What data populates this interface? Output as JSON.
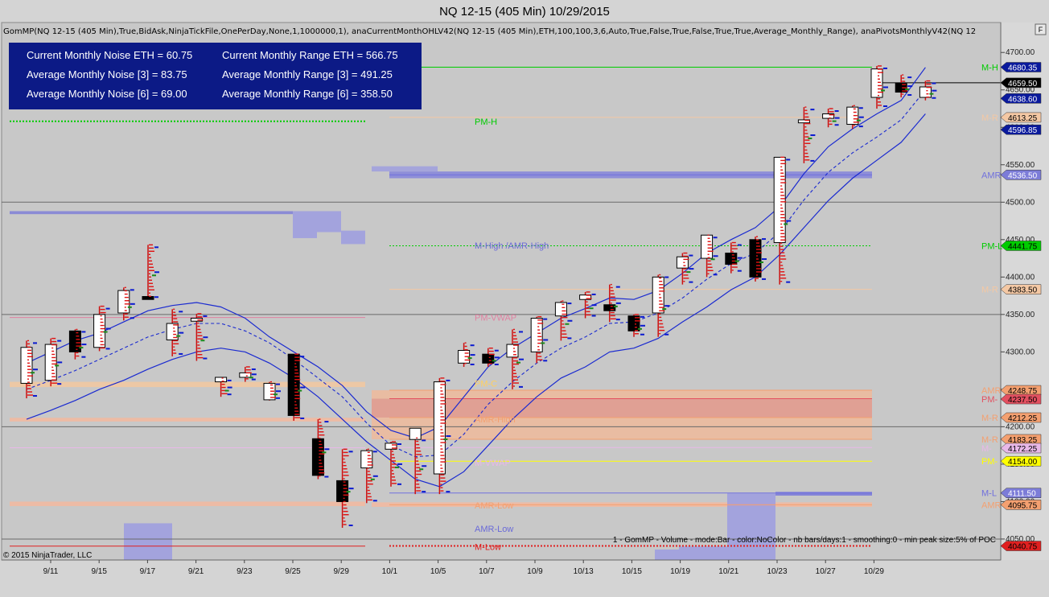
{
  "window": {
    "title": "NQ 12-15 (405 Min)  10/29/2015",
    "indicator_line": "GomMP(NQ 12-15 (405 Min),True,BidAsk,NinjaTickFile,OnePerDay,None,1,1000000,1), anaCurrentMonthOHLV42(NQ 12-15 (405 Min),ETH,100,100,3,6,Auto,True,False,True,False,True,True,Average_Monthly_Range), anaPivotsMonthlyV42(NQ 12",
    "copyright": "© 2015 NinjaTrader, LLC",
    "gom_note": "1 - GomMP - Volume - mode:Bar - color:NoColor - nb bars/days:1 - smoothing:0 - min peak size:5% of POC",
    "corner_button": "F"
  },
  "stats_box": {
    "left": [
      "Current Monthly Noise ETH = 60.75",
      "Average Monthly Noise [3] = 83.75",
      "Average Monthly Noise [6] = 69.00"
    ],
    "right": [
      "Current Monthly Range ETH = 566.75",
      "Average Monthly Range [3] = 491.25",
      "Average Monthly Range [6] = 358.50"
    ],
    "bg_color": "#0c1a86"
  },
  "chart_data": {
    "type": "candlestick",
    "title": "NQ 12-15 (405 Min)  10/29/2015",
    "x_tick_labels": [
      "9/11",
      "9/15",
      "9/17",
      "9/21",
      "9/23",
      "9/25",
      "9/29",
      "10/1",
      "10/5",
      "10/7",
      "10/9",
      "10/13",
      "10/15",
      "10/19",
      "10/21",
      "10/23",
      "10/27",
      "10/29"
    ],
    "y_ticks": [
      4050,
      4100,
      4150,
      4200,
      4250,
      4300,
      4350,
      4400,
      4450,
      4500,
      4550,
      4600,
      4650,
      4700
    ],
    "y_tick_labels": [
      "4050.00",
      "4100.00",
      "4150.00",
      "4200.00",
      "4250.00",
      "4300.00",
      "4350.00",
      "4400.00",
      "4450.00",
      "4500.00",
      "4550.00",
      "4600.00",
      "4650.00",
      "4700.00"
    ],
    "ylim": [
      4022,
      4740
    ],
    "bars": [
      {
        "o": 4258,
        "h": 4315,
        "l": 4238,
        "c": 4306
      },
      {
        "o": 4262,
        "h": 4318,
        "l": 4254,
        "c": 4310
      },
      {
        "o": 4328,
        "h": 4330,
        "l": 4290,
        "c": 4300
      },
      {
        "o": 4306,
        "h": 4361,
        "l": 4301,
        "c": 4350
      },
      {
        "o": 4352,
        "h": 4386,
        "l": 4342,
        "c": 4382
      },
      {
        "o": 4374,
        "h": 4443,
        "l": 4370,
        "c": 4370
      },
      {
        "o": 4316,
        "h": 4357,
        "l": 4294,
        "c": 4338
      },
      {
        "o": 4341,
        "h": 4351,
        "l": 4288,
        "c": 4345
      },
      {
        "o": 4260,
        "h": 4265,
        "l": 4240,
        "c": 4266
      },
      {
        "o": 4266,
        "h": 4280,
        "l": 4260,
        "c": 4272
      },
      {
        "o": 4236,
        "h": 4260,
        "l": 4235,
        "c": 4258
      },
      {
        "o": 4297,
        "h": 4297,
        "l": 4208,
        "c": 4215
      },
      {
        "o": 4184,
        "h": 4210,
        "l": 4130,
        "c": 4135
      },
      {
        "o": 4128,
        "h": 4170,
        "l": 4065,
        "c": 4100
      },
      {
        "o": 4145,
        "h": 4170,
        "l": 4098,
        "c": 4168
      },
      {
        "o": 4170,
        "h": 4180,
        "l": 4120,
        "c": 4178
      },
      {
        "o": 4183,
        "h": 4185,
        "l": 4110,
        "c": 4198
      },
      {
        "o": 4137,
        "h": 4265,
        "l": 4110,
        "c": 4260
      },
      {
        "o": 4285,
        "h": 4312,
        "l": 4280,
        "c": 4302
      },
      {
        "o": 4297,
        "h": 4305,
        "l": 4280,
        "c": 4285
      },
      {
        "o": 4293,
        "h": 4330,
        "l": 4250,
        "c": 4310
      },
      {
        "o": 4300,
        "h": 4347,
        "l": 4285,
        "c": 4345
      },
      {
        "o": 4348,
        "h": 4368,
        "l": 4315,
        "c": 4366
      },
      {
        "o": 4370,
        "h": 4380,
        "l": 4345,
        "c": 4376
      },
      {
        "o": 4363,
        "h": 4390,
        "l": 4340,
        "c": 4355
      },
      {
        "o": 4348,
        "h": 4350,
        "l": 4320,
        "c": 4328
      },
      {
        "o": 4352,
        "h": 4403,
        "l": 4320,
        "c": 4400
      },
      {
        "o": 4412,
        "h": 4432,
        "l": 4390,
        "c": 4427
      },
      {
        "o": 4425,
        "h": 4456,
        "l": 4400,
        "c": 4456
      },
      {
        "o": 4432,
        "h": 4446,
        "l": 4405,
        "c": 4417
      },
      {
        "o": 4450,
        "h": 4454,
        "l": 4394,
        "c": 4400
      },
      {
        "o": 4446,
        "h": 4560,
        "l": 4390,
        "c": 4560
      },
      {
        "o": 4606,
        "h": 4627,
        "l": 4552,
        "c": 4610
      },
      {
        "o": 4612,
        "h": 4625,
        "l": 4600,
        "c": 4618
      },
      {
        "o": 4604,
        "h": 4629,
        "l": 4598,
        "c": 4627
      },
      {
        "o": 4640,
        "h": 4682,
        "l": 4625,
        "c": 4678
      },
      {
        "o": 4659,
        "h": 4670,
        "l": 4640,
        "c": 4647
      },
      {
        "o": 4640,
        "h": 4662,
        "l": 4636,
        "c": 4654
      }
    ],
    "bands": {
      "upper": [
        4285,
        4300,
        4315,
        4325,
        4340,
        4355,
        4362,
        4366,
        4360,
        4345,
        4320,
        4300,
        4280,
        4255,
        4220,
        4195,
        4185,
        4200,
        4240,
        4280,
        4305,
        4325,
        4345,
        4358,
        4372,
        4370,
        4382,
        4405,
        4432,
        4450,
        4466,
        4494,
        4538,
        4574,
        4598,
        4618,
        4636,
        4680
      ],
      "middle": [
        4250,
        4262,
        4275,
        4290,
        4305,
        4320,
        4330,
        4338,
        4338,
        4328,
        4312,
        4290,
        4265,
        4240,
        4205,
        4175,
        4160,
        4162,
        4190,
        4230,
        4260,
        4285,
        4305,
        4320,
        4338,
        4340,
        4352,
        4372,
        4397,
        4418,
        4432,
        4460,
        4503,
        4540,
        4566,
        4587,
        4610,
        4650
      ],
      "lower": [
        4210,
        4222,
        4235,
        4250,
        4262,
        4277,
        4290,
        4300,
        4305,
        4300,
        4285,
        4265,
        4240,
        4210,
        4180,
        4155,
        4130,
        4120,
        4140,
        4175,
        4210,
        4240,
        4265,
        4280,
        4300,
        4305,
        4318,
        4340,
        4360,
        4383,
        4400,
        4430,
        4466,
        4502,
        4532,
        4556,
        4580,
        4618
      ]
    },
    "levels_right": [
      {
        "label": "M-H",
        "value": 4680.35,
        "badge": "4680.35",
        "color": "#00cc00",
        "badge_bg": "#0a1a9c",
        "badge_fg": "#ffffff"
      },
      {
        "label": "",
        "value": 4659.5,
        "badge": "4659.50",
        "color": "#000000",
        "badge_bg": "#000000",
        "badge_fg": "#ffffff"
      },
      {
        "label": "",
        "value": 4638.6,
        "badge": "4638.60",
        "color": "#0a1a9c",
        "badge_bg": "#0a1a9c",
        "badge_fg": "#ffffff"
      },
      {
        "label": "M-R",
        "value": 4613.25,
        "badge": "4613.25",
        "color": "#f4c8a4",
        "badge_bg": "#f4c8a4",
        "badge_fg": "#000000"
      },
      {
        "label": "",
        "value": 4596.85,
        "badge": "4596.85",
        "color": "#0a1a9c",
        "badge_bg": "#0a1a9c",
        "badge_fg": "#ffffff"
      },
      {
        "label": "AMR",
        "value": 4536.5,
        "badge": "4536.50",
        "color": "#7070dd",
        "badge_bg": "#7c7cd8",
        "badge_fg": "#ffffff"
      },
      {
        "label": "PM-L",
        "value": 4441.75,
        "badge": "4441.75",
        "color": "#00cc00",
        "badge_bg": "#00cc00",
        "badge_fg": "#000000"
      },
      {
        "label": "M-R",
        "value": 4383.5,
        "badge": "4383.50",
        "color": "#f4c8a4",
        "badge_bg": "#f4c8a4",
        "badge_fg": "#000000"
      },
      {
        "label": "AMR",
        "value": 4248.75,
        "badge": "4248.75",
        "color": "#f4a070",
        "badge_bg": "#f4a070",
        "badge_fg": "#000000"
      },
      {
        "label": "PM-",
        "value": 4237.5,
        "badge": "4237.50",
        "color": "#e35060",
        "badge_bg": "#e35060",
        "badge_fg": "#000000"
      },
      {
        "label": "M-R",
        "value": 4212.25,
        "badge": "4212.25",
        "color": "#f4a070",
        "badge_bg": "#f4a070",
        "badge_fg": "#000000"
      },
      {
        "label": "M-R",
        "value": 4183.25,
        "badge": "4183.25",
        "color": "#f4a070",
        "badge_bg": "#f4a070",
        "badge_fg": "#000000"
      },
      {
        "label": "M-",
        "value": 4172.25,
        "badge": "4172.25",
        "color": "#e8b8e8",
        "badge_bg": "#e8b8e8",
        "badge_fg": "#000000"
      },
      {
        "label": "PM-",
        "value": 4154.0,
        "badge": "4154.00",
        "color": "#ffff00",
        "badge_bg": "#ffff00",
        "badge_fg": "#000000"
      },
      {
        "label": "M-L",
        "value": 4111.5,
        "badge": "4111.50",
        "color": "#7070dd",
        "badge_bg": "#7c7cd8",
        "badge_fg": "#ffffff"
      },
      {
        "label": "AMR",
        "value": 4095.75,
        "badge": "4095.75",
        "color": "#f4a070",
        "badge_bg": "#f4a070",
        "badge_fg": "#000000"
      },
      {
        "label": "",
        "value": 4040.75,
        "badge": "4040.75",
        "color": "#e02020",
        "badge_bg": "#e02020",
        "badge_fg": "#000000"
      }
    ],
    "mid_labels": [
      {
        "text": "PM-H",
        "value": 4608,
        "color": "#00cc00"
      },
      {
        "text": "M-High /AMR-High",
        "value": 4442,
        "color": "#6a6ad8"
      },
      {
        "text": "PM-VWAP",
        "value": 4346,
        "color": "#e080a0"
      },
      {
        "text": "PM-C",
        "value": 4258,
        "color": "#ffd060"
      },
      {
        "text": "AMR-High",
        "value": 4210,
        "color": "#f4a070"
      },
      {
        "text": "M-VWAP",
        "value": 4152,
        "color": "#e8b8e8"
      },
      {
        "text": "AMR-Low",
        "value": 4095,
        "color": "#f4a070"
      },
      {
        "text": "AMR-Low",
        "value": 4064,
        "color": "#6a6ad8"
      },
      {
        "text": "M-Low",
        "value": 4040,
        "color": "#e02020"
      }
    ]
  }
}
